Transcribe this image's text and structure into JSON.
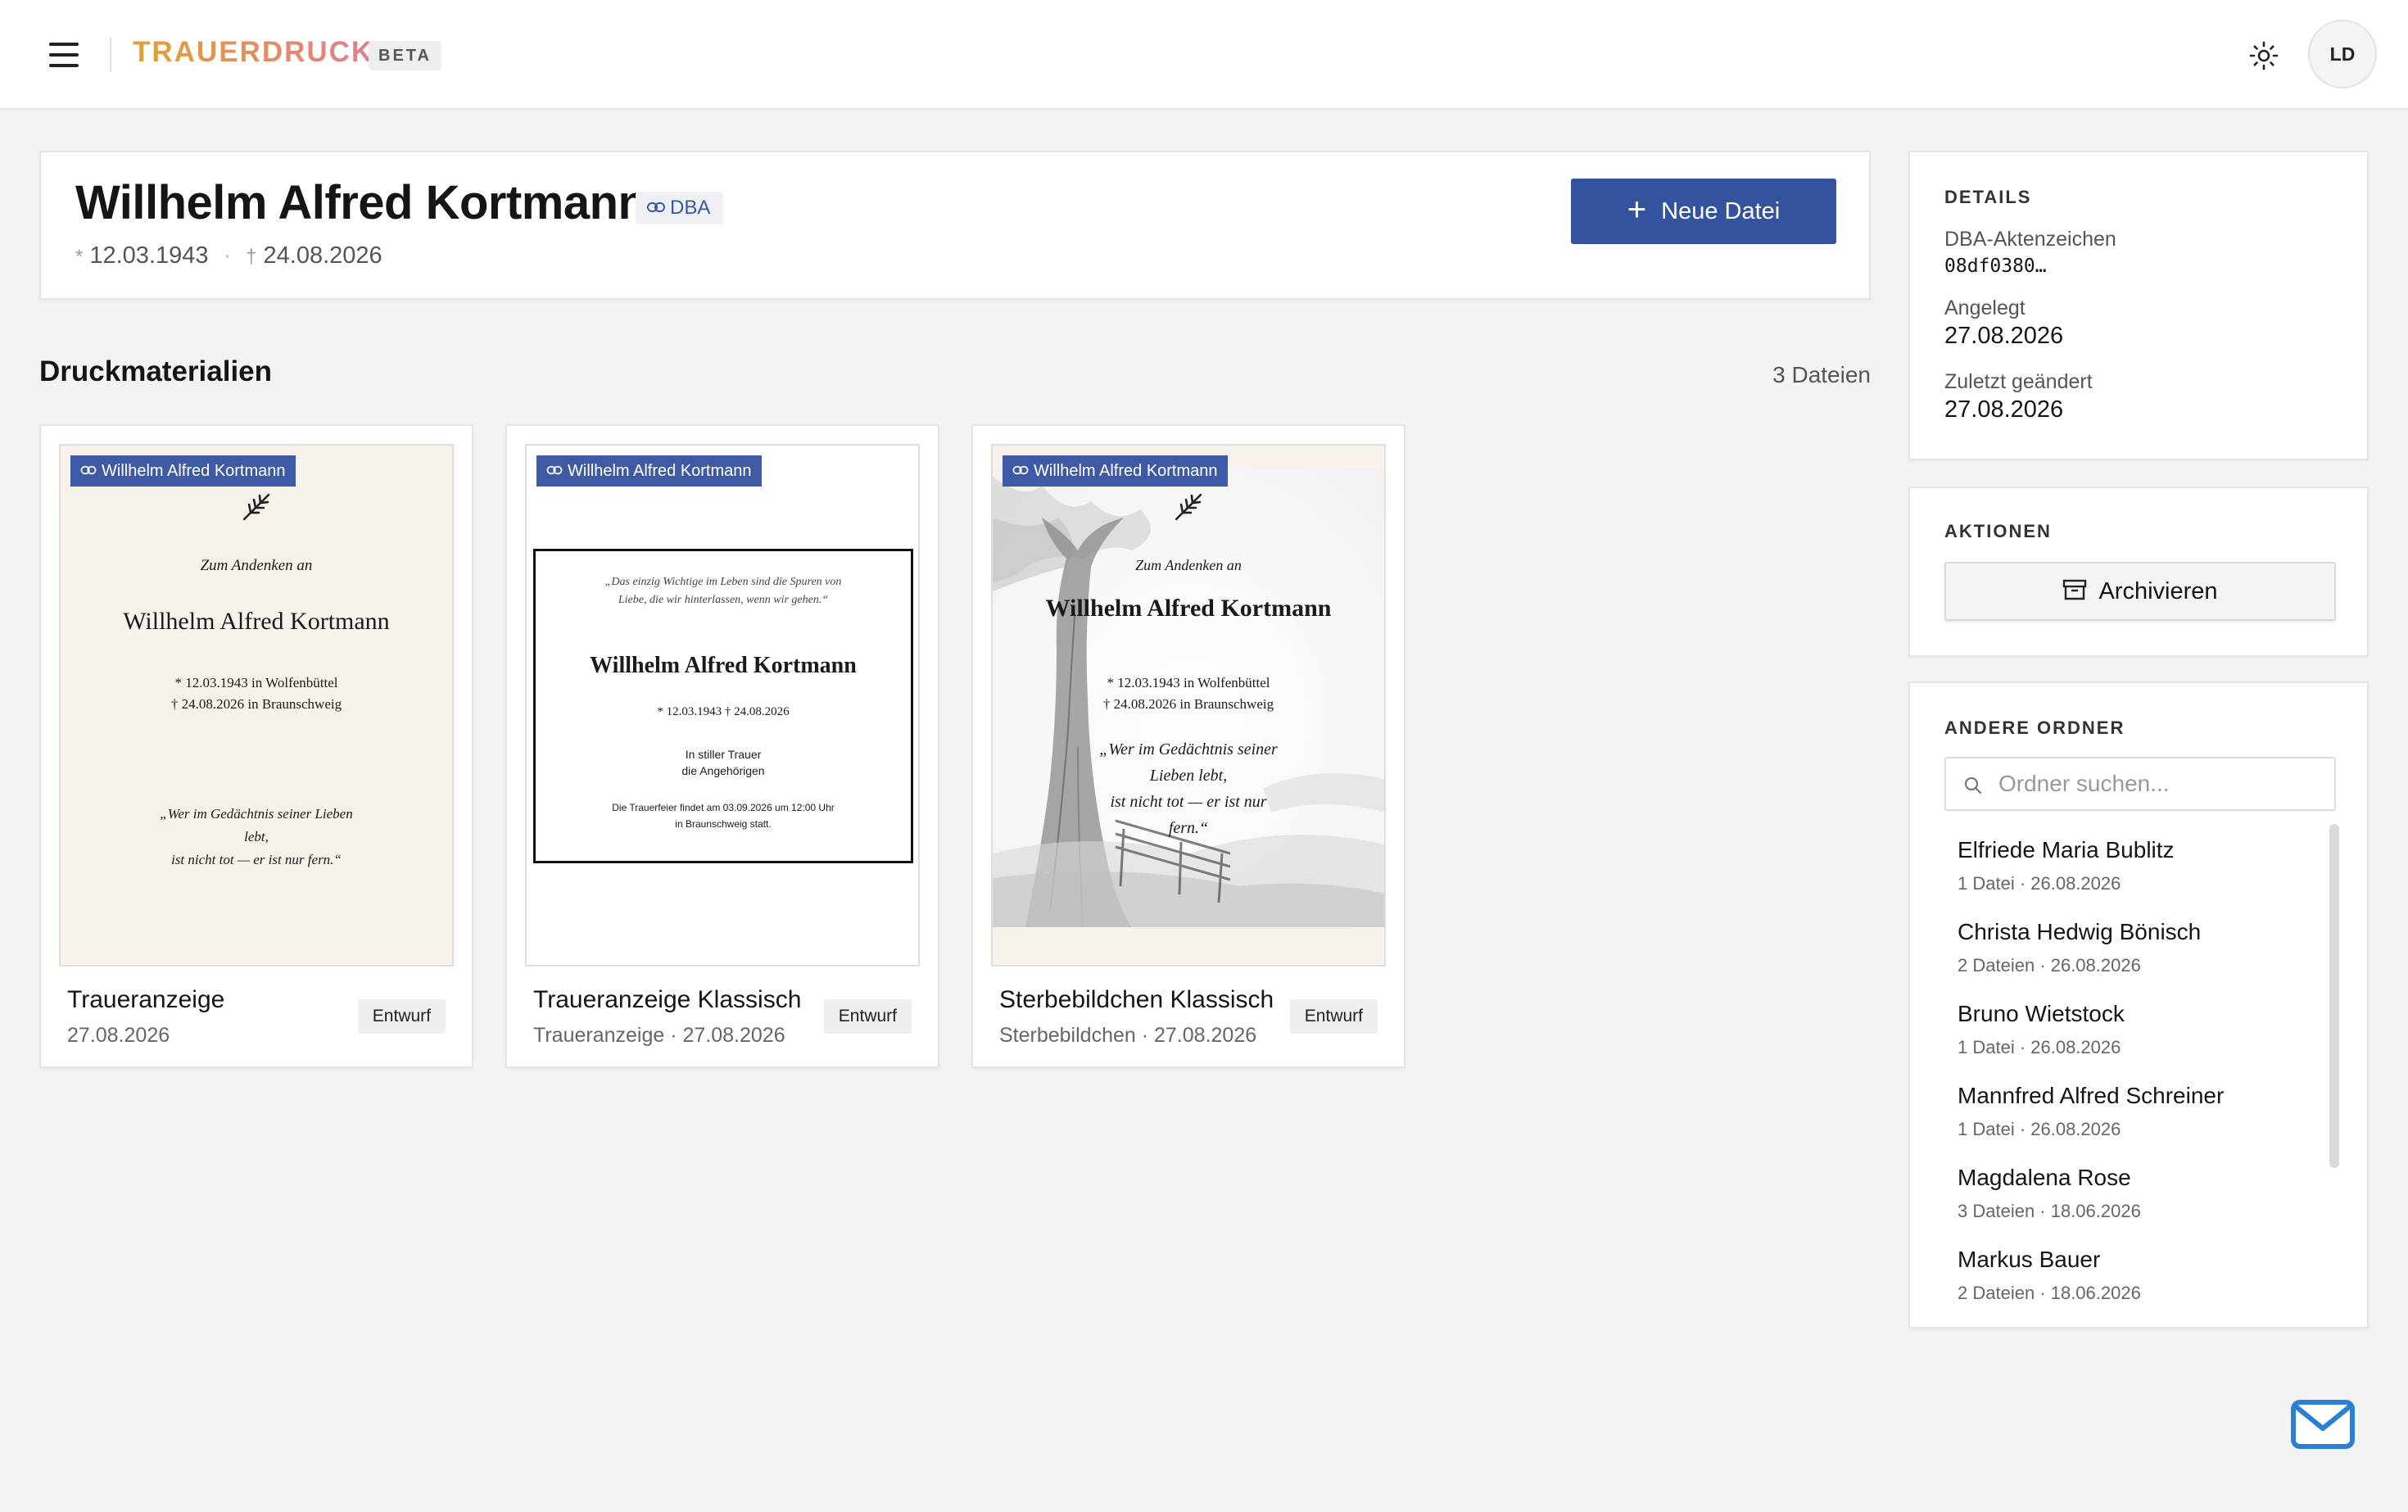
{
  "app": {
    "logo": "TRAUERDRUCK",
    "beta": "BETA",
    "user_initials": "LD"
  },
  "header": {
    "name": "Willhelm Alfred Kortmann",
    "badge": "DBA",
    "birth_symbol": "*",
    "birth": "12.03.1943",
    "separator": "·",
    "death_symbol": "†",
    "death": "24.08.2026",
    "new_button": "Neue Datei"
  },
  "section": {
    "title": "Druckmaterialien",
    "count": "3 Dateien"
  },
  "cards": [
    {
      "tag": "Willhelm Alfred Kortmann",
      "title": "Traueranzeige",
      "sub": "27.08.2026",
      "status": "Entwurf",
      "preview": {
        "intro": "Zum Andenken an",
        "name": "Willhelm Alfred Kortmann",
        "line1": "* 12.03.1943 in Wolfenbüttel",
        "line2": "† 24.08.2026 in Braunschweig",
        "quote1": "„Wer im Gedächtnis seiner Lieben",
        "quote2": "lebt,",
        "quote3": "ist nicht tot — er ist nur fern.“"
      }
    },
    {
      "tag": "Willhelm Alfred Kortmann",
      "title": "Traueranzeige Klassisch",
      "sub": "Traueranzeige · 27.08.2026",
      "status": "Entwurf",
      "preview": {
        "quote1": "„Das einzig Wichtige im Leben sind die Spuren von",
        "quote2": "Liebe, die wir hinterlassen, wenn wir gehen.“",
        "name": "Willhelm Alfred Kortmann",
        "dates": "* 12.03.1943 † 24.08.2026",
        "mourn1": "In stiller Trauer",
        "mourn2": "die Angehörigen",
        "info1": "Die Trauerfeier findet am 03.09.2026 um 12:00 Uhr",
        "info2": "in Braunschweig statt."
      }
    },
    {
      "tag": "Willhelm Alfred Kortmann",
      "title": "Sterbebildchen Klassisch",
      "sub": "Sterbebildchen · 27.08.2026",
      "status": "Entwurf",
      "preview": {
        "intro": "Zum Andenken an",
        "name": "Willhelm Alfred Kortmann",
        "line1": "* 12.03.1943 in Wolfenbüttel",
        "line2": "† 24.08.2026 in Braunschweig",
        "quote1": "„Wer im Gedächtnis seiner",
        "quote2": "Lieben lebt,",
        "quote3": "ist nicht tot — er ist nur",
        "quote4": "fern.“"
      }
    }
  ],
  "details": {
    "heading": "DETAILS",
    "dba_label": "DBA-Aktenzeichen",
    "dba_value": "08df0380…",
    "created_label": "Angelegt",
    "created_value": "27.08.2026",
    "modified_label": "Zuletzt geändert",
    "modified_value": "27.08.2026"
  },
  "actions": {
    "heading": "AKTIONEN",
    "archive": "Archivieren"
  },
  "folders": {
    "heading": "ANDERE ORDNER",
    "search_placeholder": "Ordner suchen...",
    "items": [
      {
        "name": "Elfriede Maria Bublitz",
        "meta": "1 Datei · 26.08.2026"
      },
      {
        "name": "Christa Hedwig Bönisch",
        "meta": "2 Dateien · 26.08.2026"
      },
      {
        "name": "Bruno Wietstock",
        "meta": "1 Datei · 26.08.2026"
      },
      {
        "name": "Mannfred Alfred Schreiner",
        "meta": "1 Datei · 26.08.2026"
      },
      {
        "name": "Magdalena Rose",
        "meta": "3 Dateien · 18.06.2026"
      },
      {
        "name": "Markus Bauer",
        "meta": "2 Dateien · 18.06.2026"
      }
    ]
  },
  "colors": {
    "primary": "#33539e",
    "tag": "#3e5aa4",
    "background": "#f3f3f3",
    "cream": "#f7f3ec"
  },
  "icons": [
    "menu-icon",
    "link-icon",
    "plus-icon",
    "sun-icon",
    "archive-icon",
    "search-icon",
    "mail-icon",
    "branch-icon"
  ]
}
